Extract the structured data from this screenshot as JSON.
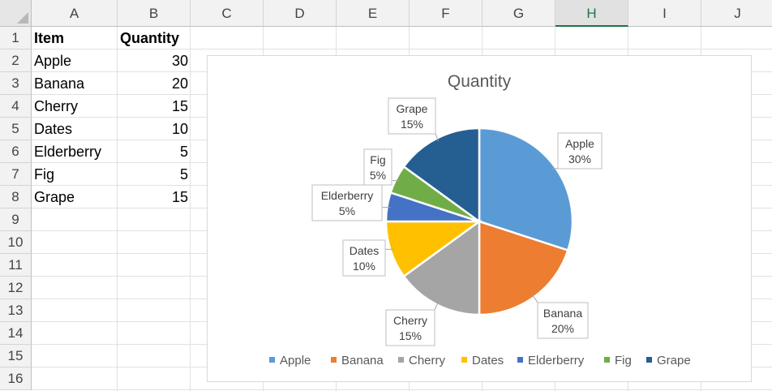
{
  "columns": [
    "A",
    "B",
    "C",
    "D",
    "E",
    "F",
    "G",
    "H",
    "I",
    "J"
  ],
  "selected_column": "H",
  "rows": [
    "1",
    "2",
    "3",
    "4",
    "5",
    "6",
    "7",
    "8",
    "9",
    "10",
    "11",
    "12",
    "13",
    "14",
    "15",
    "16"
  ],
  "table": {
    "header": {
      "item": "Item",
      "quantity": "Quantity"
    },
    "rows": [
      {
        "item": "Apple",
        "quantity": "30"
      },
      {
        "item": "Banana",
        "quantity": "20"
      },
      {
        "item": "Cherry",
        "quantity": "15"
      },
      {
        "item": "Dates",
        "quantity": "10"
      },
      {
        "item": "Elderberry",
        "quantity": "5"
      },
      {
        "item": "Fig",
        "quantity": "5"
      },
      {
        "item": "Grape",
        "quantity": "15"
      }
    ]
  },
  "chart_data": {
    "type": "pie",
    "title": "Quantity",
    "categories": [
      "Apple",
      "Banana",
      "Cherry",
      "Dates",
      "Elderberry",
      "Fig",
      "Grape"
    ],
    "values": [
      30,
      20,
      15,
      10,
      5,
      5,
      15
    ],
    "data_labels": [
      "30%",
      "20%",
      "15%",
      "10%",
      "5%",
      "5%",
      "15%"
    ],
    "colors": [
      "#5b9bd5",
      "#ed7d31",
      "#a5a5a5",
      "#ffc000",
      "#4472c4",
      "#70ad47",
      "#255e91"
    ],
    "legend_position": "bottom"
  }
}
